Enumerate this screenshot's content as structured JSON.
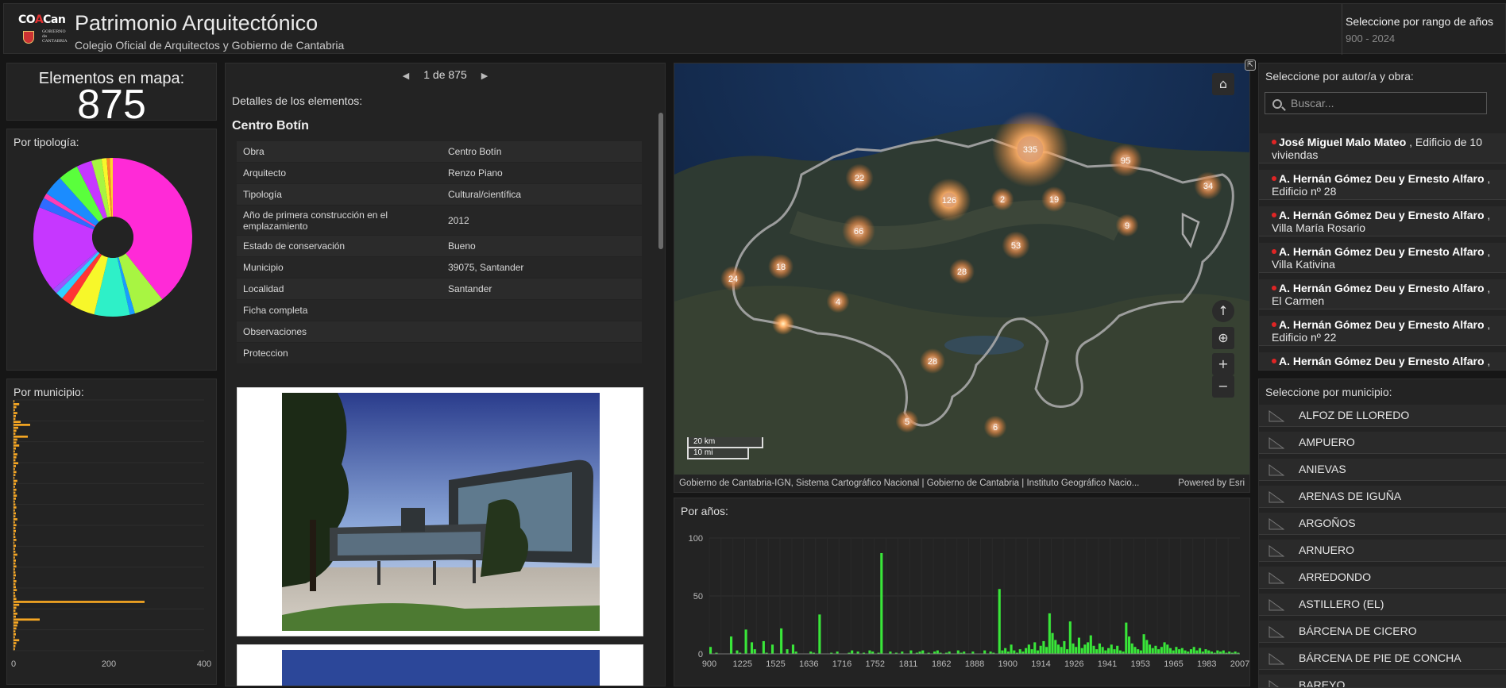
{
  "header": {
    "logo_text": "COACan",
    "logo_sub": "GOBIERNO de CANTABRIA",
    "title": "Patrimonio Arquitectónico",
    "subtitle": "Colegio Oficial de Arquitectos y Gobierno de Cantabria",
    "year_filter_label": "Seleccione por rango de años",
    "year_filter_value": "900 - 2024"
  },
  "count": {
    "label": "Elementos en mapa:",
    "value": "875"
  },
  "tipologia": {
    "title": "Por tipología:",
    "chart_data": {
      "type": "pie",
      "slices": [
        {
          "value": 38,
          "color": "#ff2ad7"
        },
        {
          "value": 6,
          "color": "#a8f542"
        },
        {
          "value": 1,
          "color": "#1a9cff"
        },
        {
          "value": 7,
          "color": "#2ef0c8"
        },
        {
          "value": 5,
          "color": "#f7f72a"
        },
        {
          "value": 2,
          "color": "#ff3535"
        },
        {
          "value": 1.5,
          "color": "#2fd0ff"
        },
        {
          "value": 1,
          "color": "#9b55ff"
        },
        {
          "value": 17,
          "color": "#c637ff"
        },
        {
          "value": 2,
          "color": "#2f6bff"
        },
        {
          "value": 1,
          "color": "#ff3cb5"
        },
        {
          "value": 4,
          "color": "#1b8cff"
        },
        {
          "value": 4,
          "color": "#5aff3c"
        },
        {
          "value": 3,
          "color": "#c637ff"
        },
        {
          "value": 2,
          "color": "#a8f542"
        },
        {
          "value": 1,
          "color": "#f7f72a"
        },
        {
          "value": 0.6,
          "color": "#ff8a2a"
        },
        {
          "value": 0.6,
          "color": "#ffd52a"
        }
      ]
    }
  },
  "municipio_chart": {
    "title": "Por municipio:",
    "chart_data": {
      "type": "bar",
      "orientation": "horizontal",
      "xlim": [
        0,
        400
      ],
      "xticks": [
        "0",
        "200",
        "400"
      ],
      "values": [
        2,
        12,
        6,
        3,
        8,
        5,
        4,
        15,
        35,
        10,
        6,
        4,
        30,
        8,
        6,
        12,
        5,
        3,
        8,
        6,
        4,
        10,
        5,
        3,
        6,
        4,
        2,
        8,
        5,
        3,
        6,
        4,
        7,
        5,
        3,
        4,
        6,
        3,
        5,
        4,
        8,
        3,
        6,
        4,
        5,
        3,
        4,
        6,
        2,
        5,
        3,
        4,
        8,
        3,
        5,
        4,
        6,
        3,
        4,
        5,
        3,
        6,
        4,
        5,
        7,
        3,
        4,
        6,
        275,
        12,
        6,
        4,
        8,
        5,
        55,
        10,
        8,
        6,
        4,
        5,
        3,
        12,
        6,
        4,
        3
      ],
      "bar_color": "#f5a623"
    }
  },
  "details": {
    "pager_text": "1 de 875",
    "heading": "Detalles de los elementos:",
    "name": "Centro Botín",
    "rows": [
      {
        "k": "Obra",
        "v": "Centro Botín"
      },
      {
        "k": "Arquitecto",
        "v": "Renzo Piano"
      },
      {
        "k": "Tipología",
        "v": "Cultural/científica"
      },
      {
        "k": "Año de primera construcción en el emplazamiento",
        "v": "2012"
      },
      {
        "k": "Estado de conservación",
        "v": "Bueno"
      },
      {
        "k": "Municipio",
        "v": "39075, Santander"
      },
      {
        "k": "Localidad",
        "v": "Santander"
      },
      {
        "k": "Ficha completa",
        "v": ""
      },
      {
        "k": "Observaciones",
        "v": ""
      },
      {
        "k": "Proteccion",
        "v": ""
      }
    ]
  },
  "map": {
    "clusters": [
      "335",
      "95",
      "34",
      "22",
      "126",
      "2",
      "19",
      "9",
      "66",
      "53",
      "18",
      "24",
      "28",
      "4",
      "28",
      "5",
      "6"
    ],
    "scale_km": "20 km",
    "scale_mi": "10 mi",
    "attribution": "Gobierno de Cantabria-IGN, Sistema Cartográfico Nacional | Gobierno de Cantabria | Instituto Geográfico Nacio...",
    "powered": "Powered by Esri"
  },
  "years_chart": {
    "title": "Por años:",
    "chart_data": {
      "type": "bar",
      "ylim": [
        0,
        100
      ],
      "yticks": [
        "100",
        "50",
        "0"
      ],
      "xticks": [
        "900",
        "1225",
        "1525",
        "1636",
        "1716",
        "1752",
        "1811",
        "1862",
        "1888",
        "1900",
        "1914",
        "1926",
        "1941",
        "1953",
        "1965",
        "1983",
        "2007"
      ],
      "values": [
        6,
        0,
        1,
        0,
        0,
        0,
        0,
        15,
        0,
        3,
        1,
        0,
        21,
        0,
        10,
        4,
        0,
        0,
        11,
        1,
        0,
        8,
        0,
        0,
        22,
        0,
        4,
        0,
        8,
        2,
        0,
        0,
        0,
        0,
        2,
        1,
        0,
        34,
        0,
        0,
        0,
        1,
        0,
        2,
        0,
        0,
        0,
        1,
        3,
        0,
        2,
        0,
        1,
        0,
        3,
        2,
        0,
        1,
        87,
        0,
        0,
        2,
        0,
        1,
        0,
        2,
        0,
        0,
        3,
        0,
        1,
        2,
        3,
        0,
        1,
        0,
        2,
        3,
        1,
        0,
        1,
        2,
        0,
        0,
        3,
        1,
        2,
        0,
        0,
        2,
        0,
        0,
        0,
        3,
        0,
        2,
        1,
        0,
        56,
        3,
        5,
        2,
        8,
        3,
        1,
        4,
        2,
        5,
        8,
        4,
        10,
        3,
        7,
        11,
        6,
        35,
        18,
        12,
        8,
        6,
        11,
        4,
        28,
        9,
        6,
        14,
        5,
        8,
        10,
        16,
        7,
        4,
        9,
        6,
        3,
        5,
        8,
        4,
        7,
        3,
        2,
        27,
        15,
        9,
        6,
        4,
        3,
        17,
        12,
        8,
        5,
        7,
        4,
        6,
        10,
        8,
        5,
        3,
        6,
        4,
        5,
        3,
        2,
        4,
        6,
        3,
        5,
        2,
        4,
        3,
        2,
        1,
        3,
        2,
        3,
        1,
        2,
        1,
        2,
        1
      ],
      "bar_color": "#39e639"
    }
  },
  "authors": {
    "label": "Seleccione por autor/a y obra:",
    "search_placeholder": "Buscar...",
    "items": [
      {
        "author": "José Miguel Malo Mateo",
        "work": "Edificio de 10 viviendas"
      },
      {
        "author": "A. Hernán Gómez Deu y Ernesto Alfaro",
        "work": "Edificio nº 28"
      },
      {
        "author": "A. Hernán Gómez Deu y Ernesto Alfaro",
        "work": "Villa María Rosario"
      },
      {
        "author": "A. Hernán Gómez Deu y Ernesto Alfaro",
        "work": "Villa Kativina"
      },
      {
        "author": "A. Hernán Gómez Deu y Ernesto Alfaro",
        "work": "El Carmen"
      },
      {
        "author": "A. Hernán Gómez Deu y Ernesto Alfaro",
        "work": "Edificio nº 22"
      },
      {
        "author": "A. Hernán Gómez Deu y Ernesto Alfaro",
        "work": ""
      }
    ]
  },
  "municipios": {
    "label": "Seleccione por municipio:",
    "items": [
      "ALFOZ DE LLOREDO",
      "AMPUERO",
      "ANIEVAS",
      "ARENAS DE IGUÑA",
      "ARGOÑOS",
      "ARNUERO",
      "ARREDONDO",
      "ASTILLERO (EL)",
      "BÁRCENA DE CICERO",
      "BÁRCENA DE PIE DE CONCHA",
      "BAREYO"
    ]
  }
}
